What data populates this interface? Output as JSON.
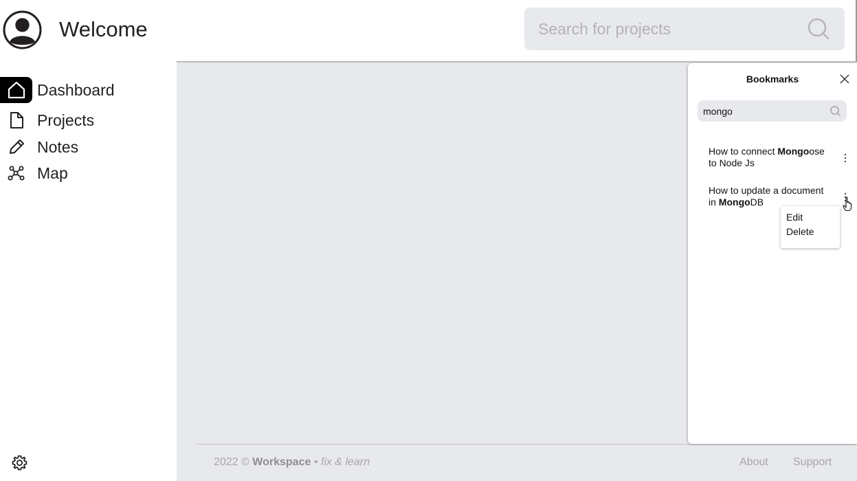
{
  "header": {
    "welcome": "Welcome",
    "search_placeholder": "Search for projects"
  },
  "sidebar": {
    "items": [
      {
        "label": "Dashboard",
        "icon": "home-icon",
        "active": true
      },
      {
        "label": "Projects",
        "icon": "file-icon",
        "active": false
      },
      {
        "label": "Notes",
        "icon": "pencil-icon",
        "active": false
      },
      {
        "label": "Map",
        "icon": "graph-icon",
        "active": false
      }
    ],
    "settings_icon": "gear-icon"
  },
  "bookmarks": {
    "title": "Bookmarks",
    "search_value": "mongo",
    "items": [
      {
        "line1_before": "How to connect ",
        "line1_bold": "Mongo",
        "line1_after": "ose",
        "line2": "to Node Js"
      },
      {
        "line1": "How to update a document",
        "line2_before": "in ",
        "line2_bold": "Mongo",
        "line2_after": "DB"
      }
    ],
    "menu": {
      "edit": "Edit",
      "delete": "Delete"
    }
  },
  "footer": {
    "year": "2022 ©",
    "brand": "Workspace",
    "separator": "•",
    "tagline": "fix & learn",
    "about": "About",
    "support": "Support"
  },
  "colors": {
    "background": "#e8e9ed",
    "active_nav": "#000000",
    "text": "#231f20",
    "muted": "#a6a6ab"
  }
}
